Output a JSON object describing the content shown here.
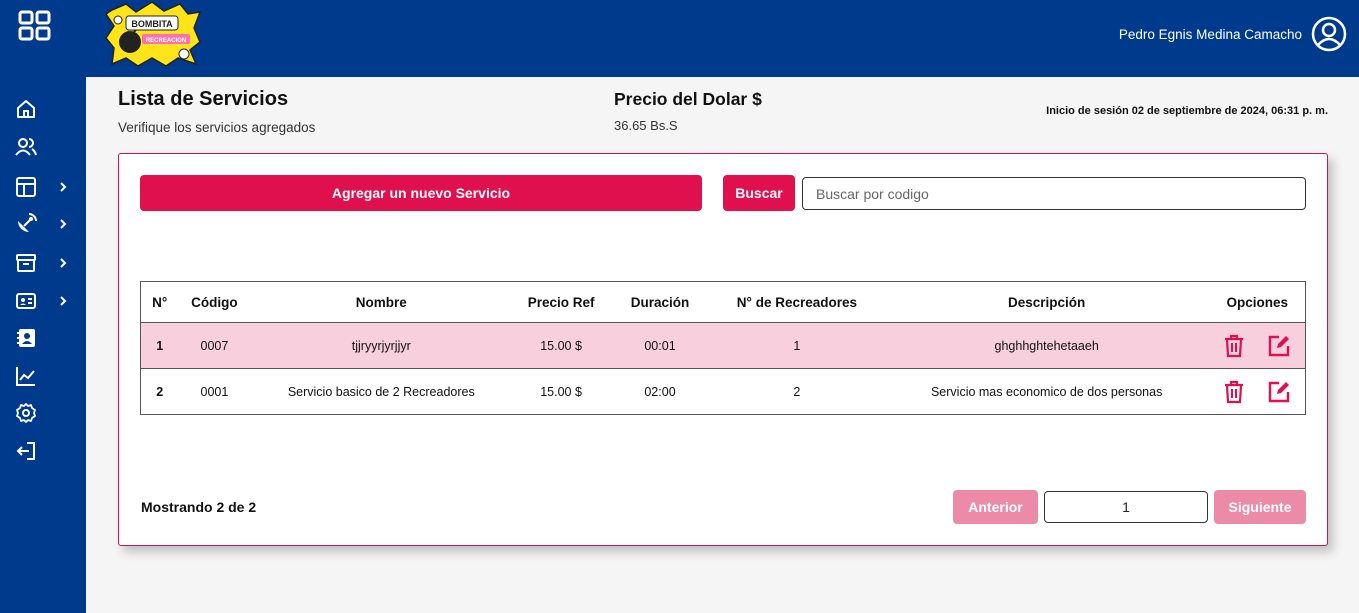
{
  "header": {
    "logo_text_1": "BOMBITA",
    "logo_text_2": "RECREACION",
    "user_name": "Pedro Egnis Medina Camacho"
  },
  "sidebar": {
    "items": [
      {
        "name": "home",
        "has_submenu": false
      },
      {
        "name": "users",
        "has_submenu": false
      },
      {
        "name": "layout",
        "has_submenu": true
      },
      {
        "name": "satellite",
        "has_submenu": true
      },
      {
        "name": "archive",
        "has_submenu": true
      },
      {
        "name": "id-card",
        "has_submenu": true
      },
      {
        "name": "contact-book",
        "has_submenu": false
      },
      {
        "name": "chart",
        "has_submenu": false
      },
      {
        "name": "settings",
        "has_submenu": false
      },
      {
        "name": "logout",
        "has_submenu": false
      }
    ]
  },
  "page": {
    "title": "Lista de Servicios",
    "subtitle": "Verifique los servicios agregados",
    "dolar_title": "Precio del Dolar $",
    "dolar_value": "36.65 Bs.S",
    "session": "Inicio de sesión 02 de septiembre de 2024, 06:31 p. m."
  },
  "toolbar": {
    "add_label": "Agregar un nuevo Servicio",
    "search_label": "Buscar",
    "search_placeholder": "Buscar por codigo",
    "search_value": ""
  },
  "table": {
    "headers": {
      "num": "N°",
      "codigo": "Código",
      "nombre": "Nombre",
      "precio": "Precio Ref",
      "duracion": "Duración",
      "recreadores": "N° de Recreadores",
      "descripcion": "Descripción",
      "opciones": "Opciones"
    },
    "rows": [
      {
        "num": "1",
        "codigo": "0007",
        "nombre": "tjjryyrjyrjjyr",
        "precio": "15.00 $",
        "duracion": "00:01",
        "recreadores": "1",
        "descripcion": "ghghhghtehetaaeh"
      },
      {
        "num": "2",
        "codigo": "0001",
        "nombre": "Servicio basico de 2 Recreadores",
        "precio": "15.00 $",
        "duracion": "02:00",
        "recreadores": "2",
        "descripcion": "Servicio mas economico de dos personas"
      }
    ]
  },
  "pagination": {
    "showing": "Mostrando 2 de 2",
    "prev_label": "Anterior",
    "page": "1",
    "next_label": "Siguiente"
  },
  "colors": {
    "nav": "#003a8c",
    "accent": "#e0104e",
    "accent_disabled": "#ec8ba8",
    "row_highlight": "#f8d0dd"
  }
}
